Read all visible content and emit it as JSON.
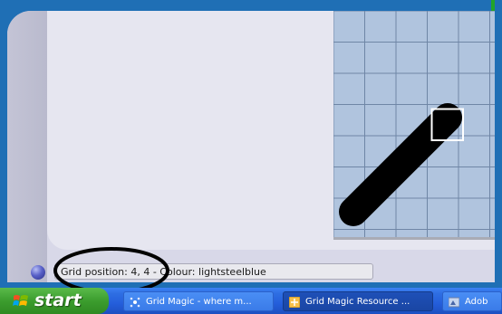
{
  "status": {
    "text": "Grid position: 4, 4 - Colour: lightsteelblue"
  },
  "grid": {
    "color": "#b0c4de",
    "line_color": "#6f86a6",
    "line_stroke_color": "#000000",
    "selected_cell": [
      4,
      4
    ]
  },
  "taskbar": {
    "start_label": "start",
    "items": [
      {
        "label": "Grid Magic - where m...",
        "icon": "grid-magic-icon"
      },
      {
        "label": "Grid Magic Resource ...",
        "icon": "grid-magic-resource-icon"
      },
      {
        "label": "Adob",
        "icon": "adobe-icon"
      }
    ]
  },
  "colors": {
    "taskbar_blue": "#245edb",
    "start_green": "#3c9d2e",
    "window_frame": "#1f6fb5",
    "panel_bg": "#e6e6f0"
  }
}
